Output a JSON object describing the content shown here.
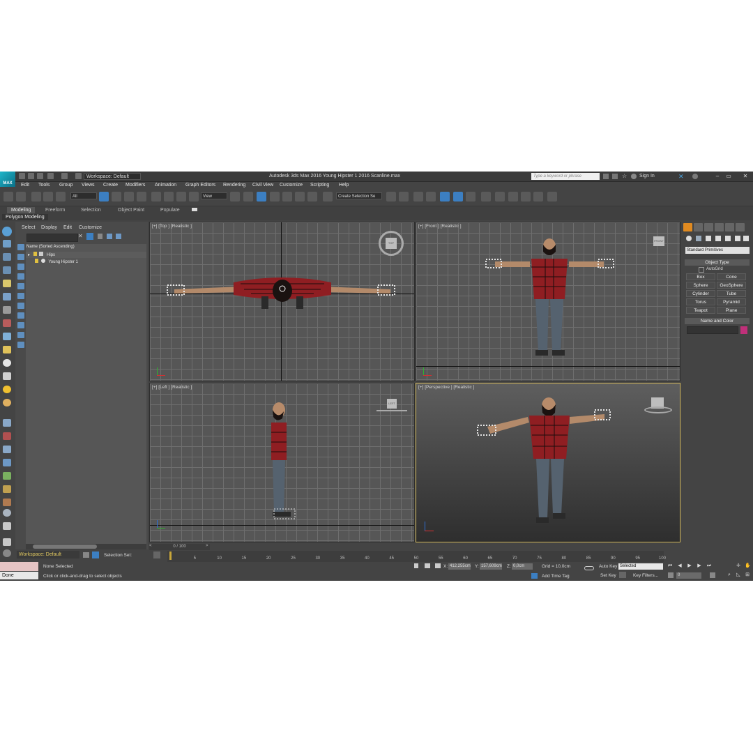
{
  "titlebar": {
    "app_icon_label": "MAX",
    "workspace": "Workspace: Default",
    "title": "Autodesk 3ds Max 2016     Young Hipster 1 2016 Scanline.max",
    "search_placeholder": "Type a keyword or phrase",
    "sign_in": "Sign In"
  },
  "menu": [
    "Edit",
    "Tools",
    "Group",
    "Views",
    "Create",
    "Modifiers",
    "Animation",
    "Graph Editors",
    "Rendering",
    "Civil View",
    "Customize",
    "Scripting",
    "Help"
  ],
  "toolbar": {
    "selection_filter": "All",
    "ref_coord": "View",
    "selection_set": "Create Selection Se"
  },
  "ribbon": {
    "tabs": [
      "Modeling",
      "Freeform",
      "Selection",
      "Object Paint",
      "Populate"
    ],
    "active_tab": "Modeling",
    "panel": "Polygon Modeling"
  },
  "scene_explorer": {
    "menu": [
      "Select",
      "Display",
      "Edit",
      "Customize"
    ],
    "header": "Name (Sorted Ascending)",
    "items": [
      "Hips",
      "Young Hipster 1"
    ],
    "workspace": "Workspace: Default",
    "selection_set_label": "Selection Set:"
  },
  "viewports": {
    "top": "[+] [Top ] [Realistic ]",
    "front": "[+] [Front ] [Realistic ]",
    "left": "[+] [Left ] [Realistic ]",
    "perspective": "[+] [Perspective ] [Realistic ]",
    "cube_top": "TOP",
    "cube_front": "FRONT",
    "cube_left": "LEFT"
  },
  "command_panel": {
    "category": "Standard Primitives",
    "object_type_title": "Object Type",
    "autogrid": "AutoGrid",
    "buttons": [
      "Box",
      "Cone",
      "Sphere",
      "GeoSphere",
      "Cylinder",
      "Tube",
      "Torus",
      "Pyramid",
      "Teapot",
      "Plane"
    ],
    "name_color_title": "Name and Color",
    "object_color": "#c0307a"
  },
  "timeline": {
    "frame": "0 / 100",
    "ticks": [
      "5",
      "10",
      "15",
      "20",
      "25",
      "30",
      "35",
      "40",
      "45",
      "50",
      "55",
      "60",
      "65",
      "70",
      "75",
      "80",
      "85",
      "90",
      "95",
      "100"
    ]
  },
  "status": {
    "selection": "None Selected",
    "prompt": "Click or click-and-drag to select objects",
    "done": "Done",
    "x_label": "X:",
    "x_value": "412,255cm",
    "y_label": "Y:",
    "y_value": "157,609cm",
    "z_label": "Z:",
    "z_value": "0,0cm",
    "grid": "Grid = 10,0cm",
    "add_time_tag": "Add Time Tag",
    "auto_key": "Auto Key",
    "set_key": "Set Key",
    "key_mode": "Selected",
    "key_filters": "Key Filters...",
    "current_frame": "0"
  }
}
